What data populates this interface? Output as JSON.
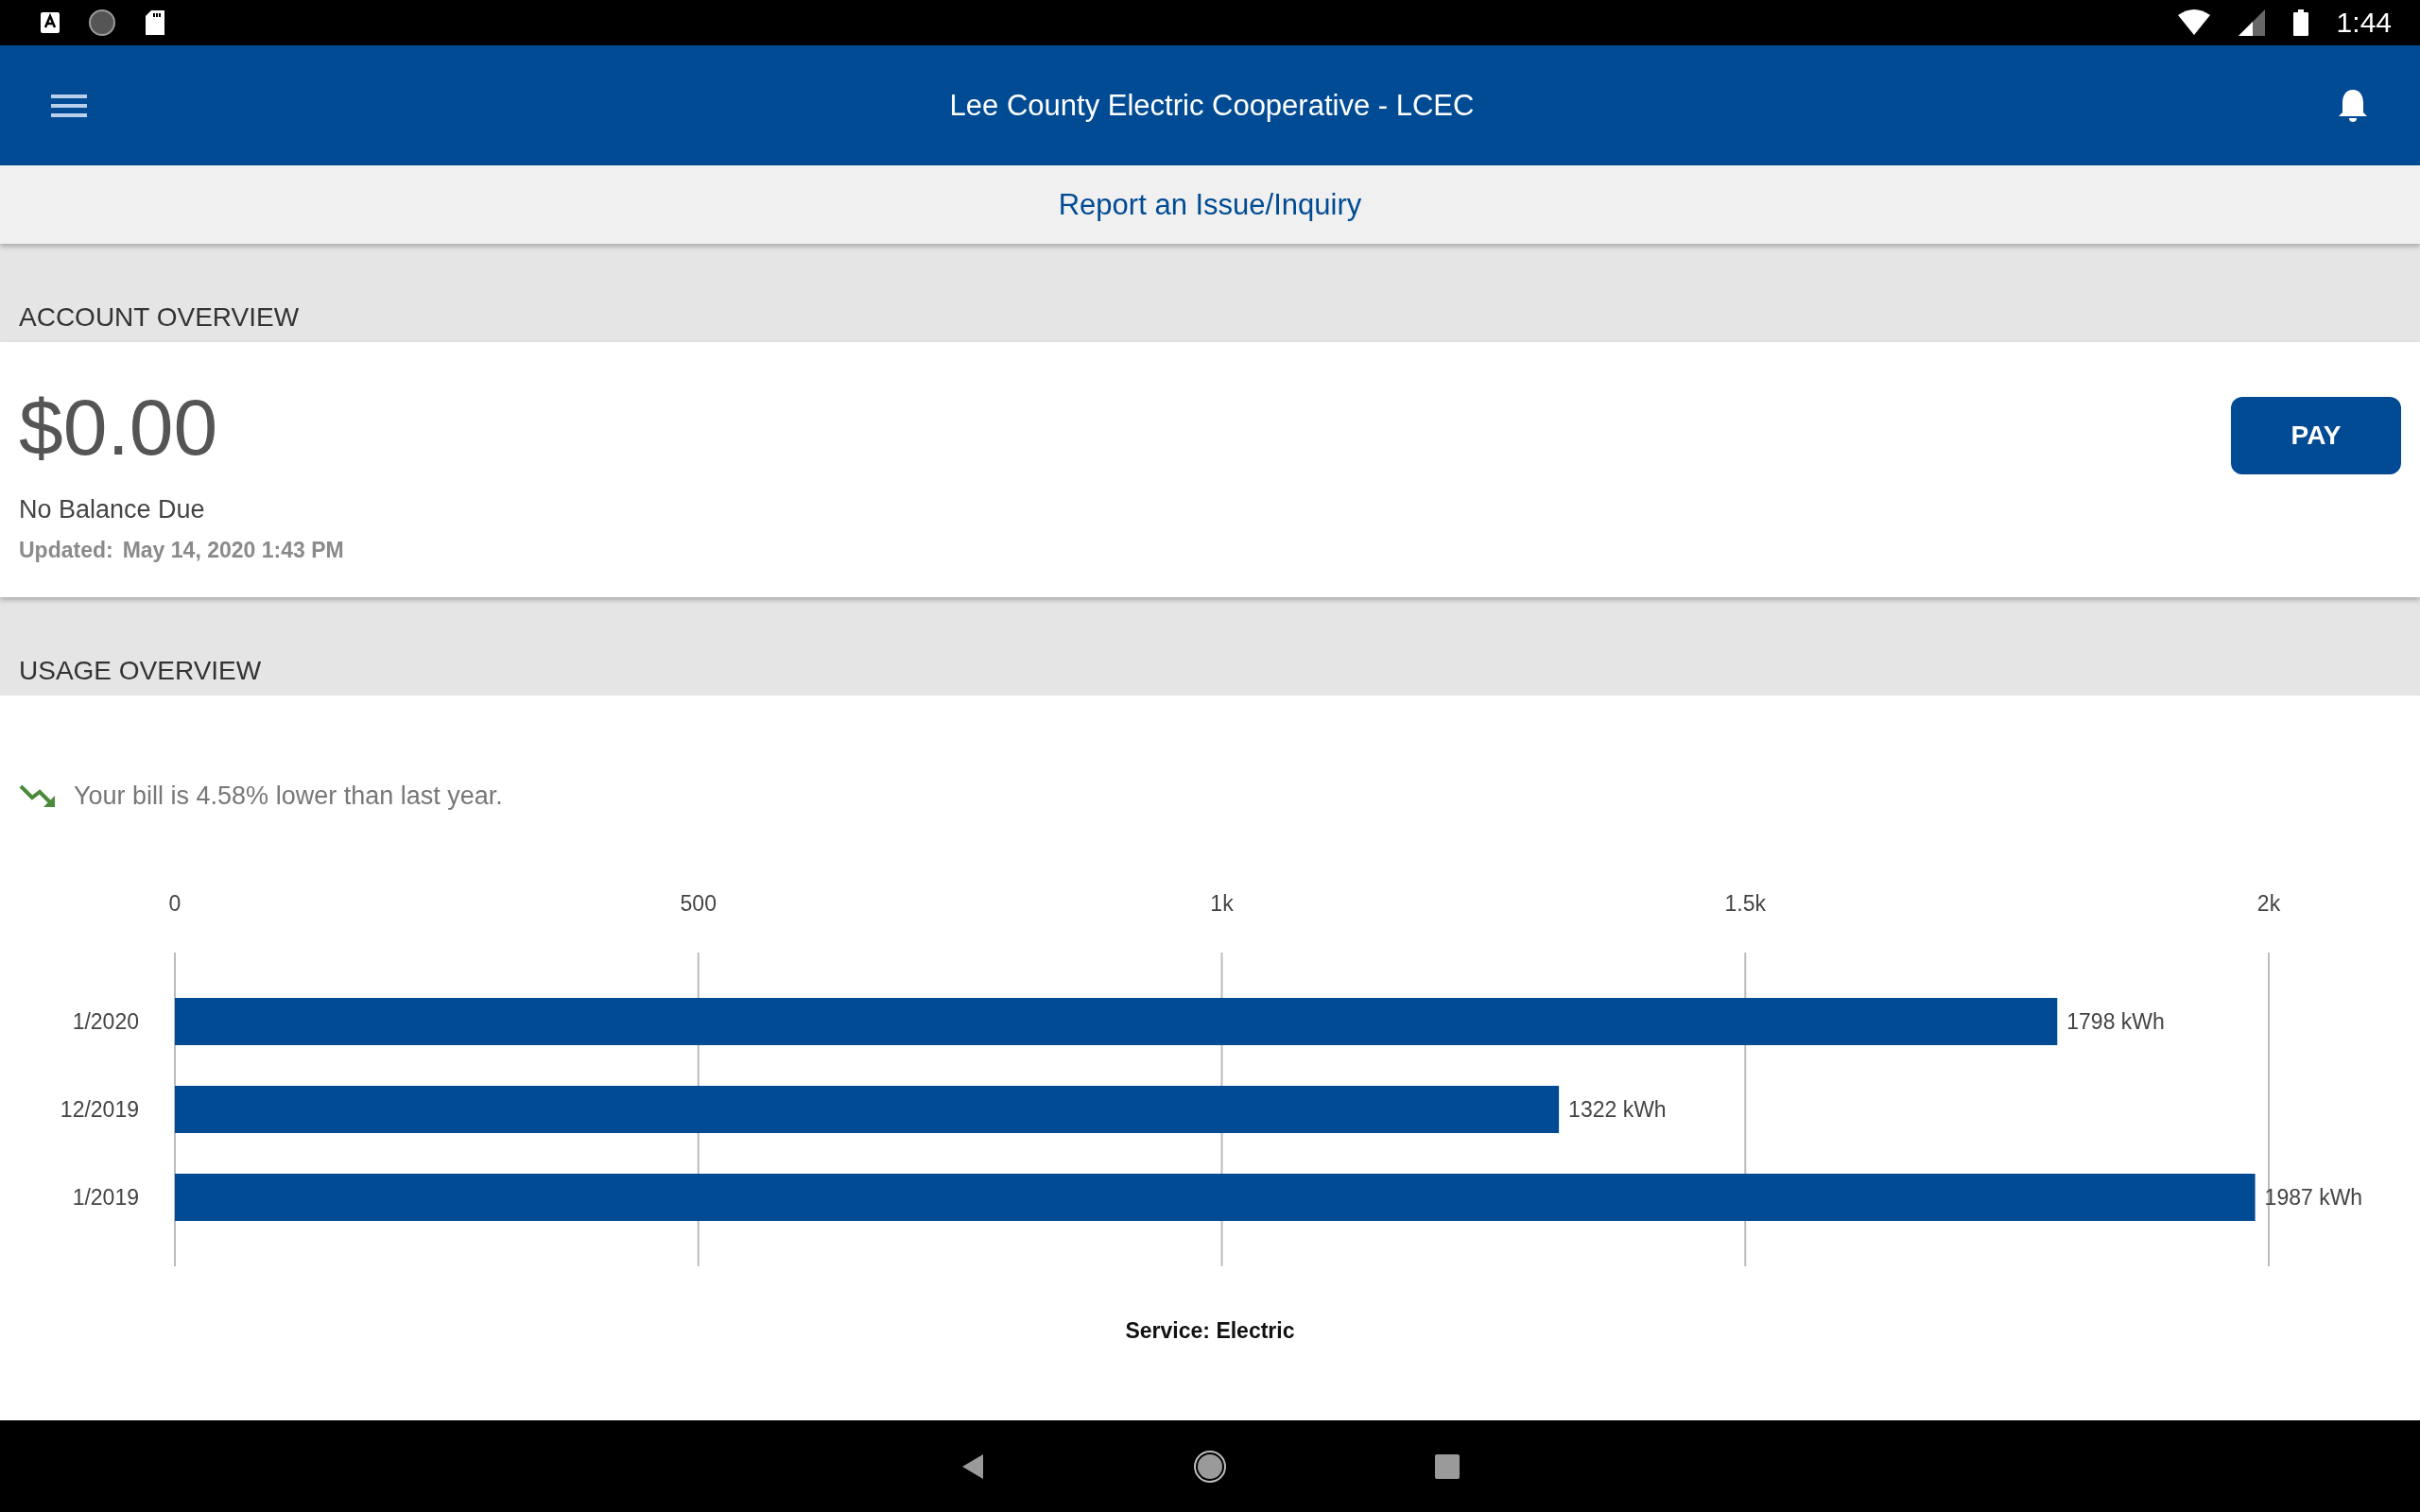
{
  "status_bar": {
    "time": "1:44"
  },
  "header": {
    "title": "Lee County Electric Cooperative - LCEC"
  },
  "report_link": "Report an Issue/Inquiry",
  "account_overview": {
    "heading": "ACCOUNT OVERVIEW",
    "balance": "$0.00",
    "balance_status": "No Balance Due",
    "updated_label": "Updated:",
    "updated_value": "May 14, 2020 1:43 PM",
    "pay_button": "PAY"
  },
  "usage_overview": {
    "heading": "USAGE OVERVIEW",
    "trend": {
      "kind": "down",
      "text": "Your bill is 4.58% lower than last year."
    },
    "chart_data": {
      "type": "bar",
      "orientation": "horizontal",
      "xlabel": "Service: Electric",
      "categories": [
        "1/2020",
        "12/2019",
        "1/2019"
      ],
      "values": [
        1798,
        1322,
        1987
      ],
      "grid": true,
      "value_labels": [
        "1798 kWh",
        "1322 kWh",
        "1987 kWh"
      ],
      "xlim": [
        0,
        2000
      ],
      "xticks": [
        0,
        {
          "value": 500,
          "label": "500"
        },
        {
          "value": 1000,
          "label": "1k"
        },
        {
          "value": 1500,
          "label": "1.5k"
        },
        {
          "value": 2000,
          "label": "2k"
        }
      ]
    }
  }
}
